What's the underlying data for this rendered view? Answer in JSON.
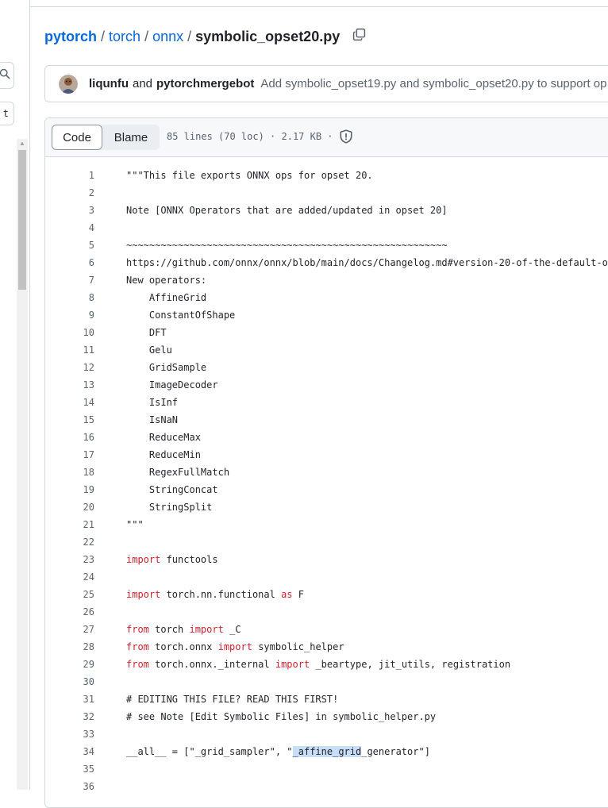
{
  "breadcrumb": {
    "repo": "pytorch",
    "sep": "/",
    "dir1": "torch",
    "dir2": "onnx",
    "file": "symbolic_opset20.py"
  },
  "sidebar": {
    "truncated_button_text": "t"
  },
  "commit": {
    "author1": "liqunfu",
    "conjunction": "and",
    "author2": "pytorchmergebot",
    "message": "Add symbolic_opset19.py and symbolic_opset20.py to support op"
  },
  "file_header": {
    "tabs": [
      {
        "label": "Code"
      },
      {
        "label": "Blame"
      }
    ],
    "meta": "85 lines (70 loc) · 2.17 KB ·"
  },
  "code_lines": [
    {
      "n": "1",
      "segs": [
        {
          "t": "\"\"\"This file exports ONNX ops for opset 20.",
          "c": ""
        }
      ]
    },
    {
      "n": "2",
      "segs": []
    },
    {
      "n": "3",
      "segs": [
        {
          "t": "Note [ONNX Operators that are added/updated in opset 20]",
          "c": ""
        }
      ]
    },
    {
      "n": "4",
      "segs": []
    },
    {
      "n": "5",
      "segs": [
        {
          "t": "~~~~~~~~~~~~~~~~~~~~~~~~~~~~~~~~~~~~~~~~~~~~~~~~~~~~~~~~",
          "c": ""
        }
      ]
    },
    {
      "n": "6",
      "segs": [
        {
          "t": "https://github.com/onnx/onnx/blob/main/docs/Changelog.md#version-20-of-the-default-o",
          "c": ""
        }
      ]
    },
    {
      "n": "7",
      "segs": [
        {
          "t": "New operators:",
          "c": ""
        }
      ]
    },
    {
      "n": "8",
      "segs": [
        {
          "t": "    AffineGrid",
          "c": ""
        }
      ]
    },
    {
      "n": "9",
      "segs": [
        {
          "t": "    ConstantOfShape",
          "c": ""
        }
      ]
    },
    {
      "n": "10",
      "segs": [
        {
          "t": "    DFT",
          "c": ""
        }
      ]
    },
    {
      "n": "11",
      "segs": [
        {
          "t": "    Gelu",
          "c": ""
        }
      ]
    },
    {
      "n": "12",
      "segs": [
        {
          "t": "    GridSample",
          "c": ""
        }
      ]
    },
    {
      "n": "13",
      "segs": [
        {
          "t": "    ImageDecoder",
          "c": ""
        }
      ]
    },
    {
      "n": "14",
      "segs": [
        {
          "t": "    IsInf",
          "c": ""
        }
      ]
    },
    {
      "n": "15",
      "segs": [
        {
          "t": "    IsNaN",
          "c": ""
        }
      ]
    },
    {
      "n": "16",
      "segs": [
        {
          "t": "    ReduceMax",
          "c": ""
        }
      ]
    },
    {
      "n": "17",
      "segs": [
        {
          "t": "    ReduceMin",
          "c": ""
        }
      ]
    },
    {
      "n": "18",
      "segs": [
        {
          "t": "    RegexFullMatch",
          "c": ""
        }
      ]
    },
    {
      "n": "19",
      "segs": [
        {
          "t": "    StringConcat",
          "c": ""
        }
      ]
    },
    {
      "n": "20",
      "segs": [
        {
          "t": "    StringSplit",
          "c": ""
        }
      ]
    },
    {
      "n": "21",
      "segs": [
        {
          "t": "\"\"\"",
          "c": ""
        }
      ]
    },
    {
      "n": "22",
      "segs": []
    },
    {
      "n": "23",
      "segs": [
        {
          "t": "import",
          "c": "kw"
        },
        {
          "t": " functools",
          "c": ""
        }
      ]
    },
    {
      "n": "24",
      "segs": []
    },
    {
      "n": "25",
      "segs": [
        {
          "t": "import",
          "c": "kw"
        },
        {
          "t": " torch.nn.functional ",
          "c": ""
        },
        {
          "t": "as",
          "c": "kw"
        },
        {
          "t": " F",
          "c": ""
        }
      ]
    },
    {
      "n": "26",
      "segs": []
    },
    {
      "n": "27",
      "segs": [
        {
          "t": "from",
          "c": "kw"
        },
        {
          "t": " torch ",
          "c": ""
        },
        {
          "t": "import",
          "c": "kw"
        },
        {
          "t": " _C",
          "c": ""
        }
      ]
    },
    {
      "n": "28",
      "segs": [
        {
          "t": "from",
          "c": "kw"
        },
        {
          "t": " torch.onnx ",
          "c": ""
        },
        {
          "t": "import",
          "c": "kw"
        },
        {
          "t": " symbolic_helper",
          "c": ""
        }
      ]
    },
    {
      "n": "29",
      "segs": [
        {
          "t": "from",
          "c": "kw"
        },
        {
          "t": " torch.onnx._internal ",
          "c": ""
        },
        {
          "t": "import",
          "c": "kw"
        },
        {
          "t": " _beartype, jit_utils, registration",
          "c": ""
        }
      ]
    },
    {
      "n": "30",
      "segs": []
    },
    {
      "n": "31",
      "segs": [
        {
          "t": "# EDITING THIS FILE? READ THIS FIRST!",
          "c": ""
        }
      ]
    },
    {
      "n": "32",
      "segs": [
        {
          "t": "# see Note [Edit Symbolic Files] in symbolic_helper.py",
          "c": ""
        }
      ]
    },
    {
      "n": "33",
      "segs": []
    },
    {
      "n": "34",
      "segs": [
        {
          "t": "__all__ = [\"_grid_sampler\", \"",
          "c": ""
        },
        {
          "t": "_affine_grid",
          "c": "hl"
        },
        {
          "t": "_generator\"]",
          "c": ""
        }
      ]
    },
    {
      "n": "35",
      "segs": []
    },
    {
      "n": "36",
      "segs": []
    }
  ]
}
